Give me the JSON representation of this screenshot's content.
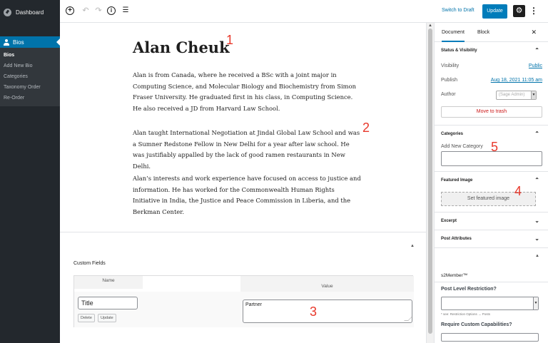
{
  "admin_menu": {
    "dashboard_label": "Dashboard",
    "bios_label": "Bios",
    "submenu": [
      "Bios",
      "Add New Bio",
      "Categories",
      "Taxonomy Order",
      "Re-Order"
    ]
  },
  "toolbar": {
    "add_icon": "plus-circle-icon",
    "undo_icon": "undo-icon",
    "redo_icon": "redo-icon",
    "info_icon": "info-icon",
    "list_icon": "list-view-icon",
    "switch_draft_label": "Switch to Draft",
    "update_label": "Update",
    "settings_icon": "gear-icon",
    "more_icon": "more-vertical-icon"
  },
  "post": {
    "title": "Alan Cheuk",
    "paragraphs": [
      "Alan is from Canada, where he received a BSc with a joint major in Computing Science, and Molecular Biology and Biochemistry from Simon Fraser University. He graduated first in his class, in Computing Science. He also received a JD from Harvard Law School.",
      "Alan taught International Negotiation at Jindal Global Law School and was a Sumner Redstone Fellow in New Delhi for a year after law school. He was justifiably appalled by the lack of good ramen restaurants in New Delhi.",
      "Alan’s interests and work experience have focused on access to justice and information. He has worked for the Commonwealth Human Rights Initiative in India, the Justice and Peace Commission in Liberia, and the Berkman Center."
    ]
  },
  "annotations": [
    "1",
    "2",
    "3",
    "4",
    "5"
  ],
  "custom_fields": {
    "title": "Custom Fields",
    "col_name": "Name",
    "col_value": "Value",
    "key_value": "Title",
    "value_value": "Partner",
    "delete_label": "Delete",
    "update_label": "Update"
  },
  "settings": {
    "tab_document": "Document",
    "tab_block": "Block",
    "close_icon": "close-icon",
    "status_title": "Status & Visibility",
    "visibility_label": "Visibility",
    "visibility_value": "Public",
    "publish_label": "Publish",
    "publish_value": "Aug 18, 2021 11:05 am",
    "author_label": "Author",
    "author_value": "(Sage Admin)",
    "trash_label": "Move to trash",
    "categories_title": "Categories",
    "add_category_label": "Add New Category",
    "featured_title": "Featured Image",
    "set_featured_label": "Set featured image",
    "excerpt_title": "Excerpt",
    "attributes_title": "Post Attributes",
    "s2_title": "s2Member™",
    "level_label": "Post Level Restriction?",
    "note": "* see: Restriction Options → Posts",
    "caps_label": "Require Custom Capabilities?"
  }
}
